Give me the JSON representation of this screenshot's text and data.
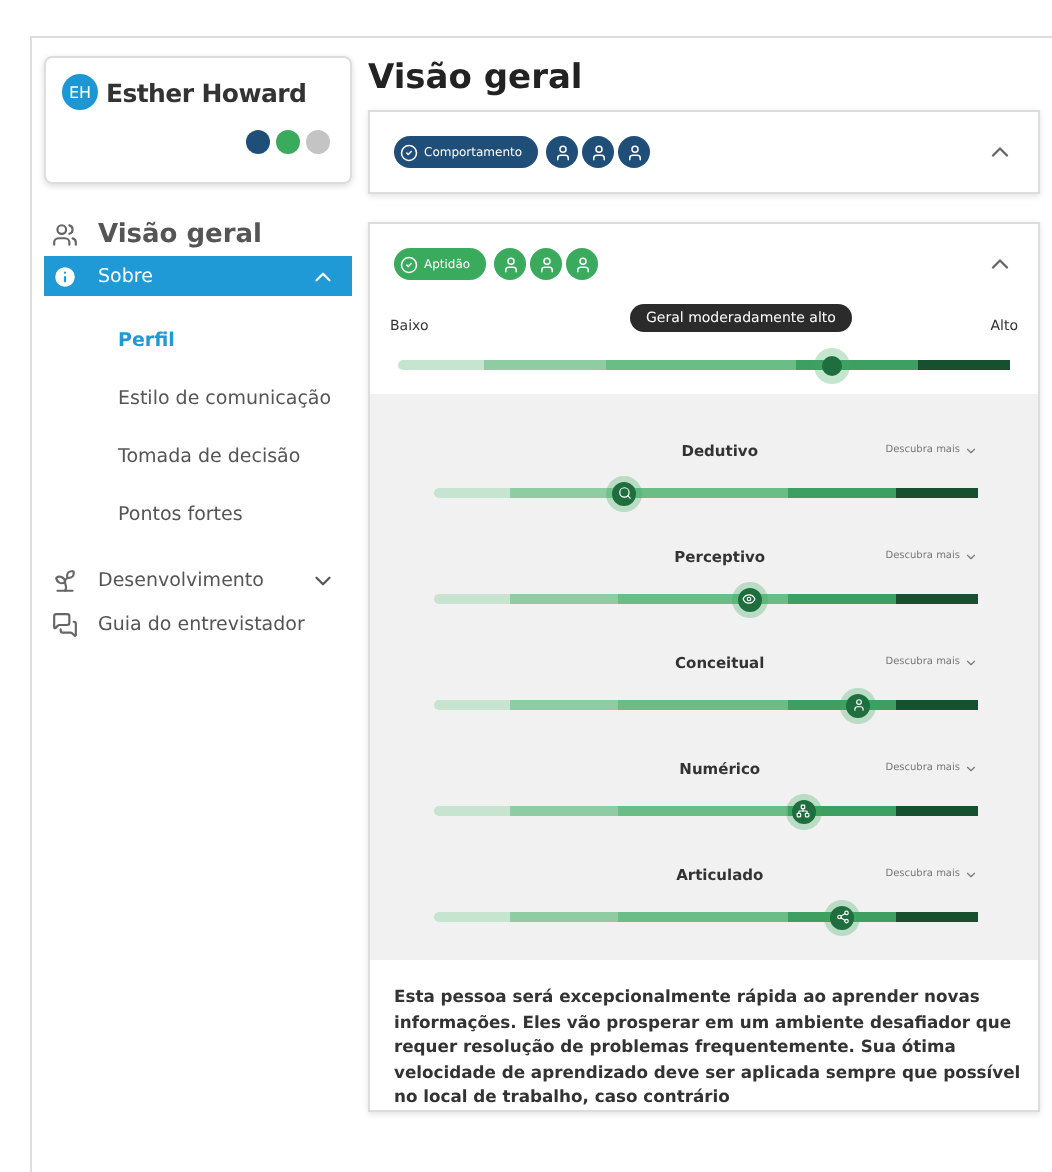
{
  "profile": {
    "initials": "EH",
    "name": "Esther Howard",
    "badges": [
      {
        "color": "#1f4e79"
      },
      {
        "color": "#3aaa5c"
      },
      {
        "color": "#c4c4c4"
      }
    ]
  },
  "sidebar": {
    "items": [
      {
        "kind": "heading",
        "label": "Visão geral",
        "selected": false
      },
      {
        "kind": "group",
        "label": "Sobre",
        "selected": true,
        "expanded": true,
        "children": [
          {
            "label": "Perfil",
            "selected": true
          },
          {
            "label": "Estilo de comunicação",
            "selected": false
          },
          {
            "label": "Tomada de decisão",
            "selected": false
          },
          {
            "label": "Pontos fortes",
            "selected": false
          }
        ]
      },
      {
        "kind": "group",
        "label": "Desenvolvimento",
        "selected": false,
        "expanded": false
      },
      {
        "kind": "link",
        "label": "Guia do entrevistador",
        "selected": false
      }
    ]
  },
  "page_title": "Visão geral",
  "cards": [
    {
      "pill": "Comportamento",
      "color": "#1f4e79",
      "expanded": true
    },
    {
      "pill": "Aptidão",
      "color": "#3aaa5c",
      "expanded": true,
      "overall": {
        "low": "Baixo",
        "high": "Alto",
        "tooltip": "Geral moderadamente alto",
        "level": 0.71
      },
      "traits": [
        {
          "name": "Dedutivo",
          "more": "Descubra mais",
          "level": 0.35
        },
        {
          "name": "Perceptivo",
          "more": "Descubra mais",
          "level": 0.58
        },
        {
          "name": "Conceitual",
          "more": "Descubra mais",
          "level": 0.78
        },
        {
          "name": "Numérico",
          "more": "Descubra mais",
          "level": 0.68
        },
        {
          "name": "Articulado",
          "more": "Descubra mais",
          "level": 0.75
        }
      ],
      "summary": "Esta pessoa será excepcionalmente rápida ao aprender novas informações. Eles vão prosperar em um ambiente desafiador que requer resolução de problemas frequentemente. Sua ótima velocidade de aprendizado deve ser aplicada sempre que possível no local de trabalho, caso contrário"
    }
  ]
}
